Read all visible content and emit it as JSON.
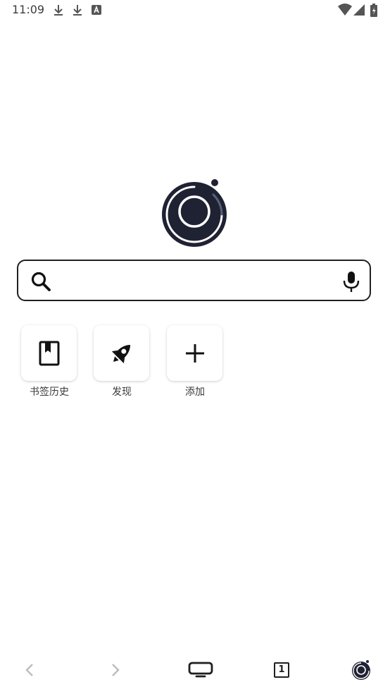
{
  "status_bar": {
    "time": "11:09",
    "icons": [
      "download-icon",
      "download-icon",
      "a-badge-icon"
    ],
    "right_icons": [
      "wifi-icon",
      "signal-icon",
      "battery-icon"
    ]
  },
  "logo": {
    "name": "browser-logo",
    "color": "#1f2233"
  },
  "search": {
    "value": "",
    "placeholder": "",
    "search_icon": "search-icon",
    "mic_icon": "mic-icon"
  },
  "shortcuts": [
    {
      "label": "书签历史",
      "icon": "bookmark-icon"
    },
    {
      "label": "发现",
      "icon": "rocket-icon"
    },
    {
      "label": "添加",
      "icon": "plus-icon"
    }
  ],
  "bottom_nav": {
    "back_icon": "chevron-left-icon",
    "forward_icon": "chevron-right-icon",
    "tv_icon": "tv-mode-icon",
    "tab_count": "1",
    "menu_icon": "browser-logo-icon"
  },
  "colors": {
    "accent": "#1f1f1f",
    "disabled": "#bdbdbd",
    "background": "#ffffff"
  }
}
